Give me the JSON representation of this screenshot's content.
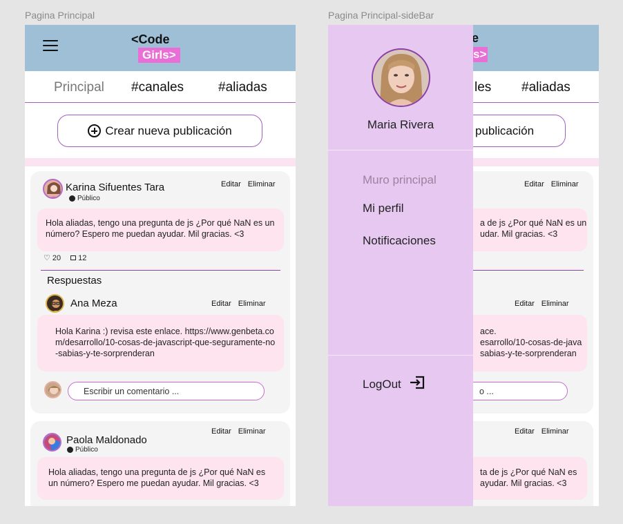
{
  "frames": {
    "left_label": "Pagina Principal",
    "right_label": "Pagina Principal-sideBar"
  },
  "header": {
    "logo_line1": "<Code",
    "logo_line2": "Girls>"
  },
  "tabs": [
    {
      "label": "Principal"
    },
    {
      "label": "#canales"
    },
    {
      "label": "#aliadas"
    }
  ],
  "create_button": "Crear nueva publicación",
  "posts": [
    {
      "author": "Karina Sifuentes Tara",
      "visibility": "Público",
      "edit": "Editar",
      "delete": "Eliminar",
      "body": "Hola aliadas, tengo una pregunta de js ¿Por qué NaN es un número? Espero me puedan ayudar. Mil gracias. <3",
      "likes": "20",
      "comments": "12",
      "replies_title": "Respuestas",
      "reply": {
        "author": "Ana Meza",
        "edit": "Editar",
        "delete": "Eliminar",
        "body": "Hola Karina :) revisa este enlace. https://www.genbeta.com/desarrollo/10-cosas-de-javascript-que-seguramente-no-sabias-y-te-sorprenderan"
      },
      "comment_placeholder": "Escribir un comentario ..."
    },
    {
      "author": "Paola Maldonado",
      "visibility": "Público",
      "edit": "Editar",
      "delete": "Eliminar",
      "body": "Hola aliadas, tengo una pregunta de js ¿Por qué NaN es un número? Espero me puedan ayudar. Mil gracias. <3"
    }
  ],
  "right_visible": {
    "logo_line1_fragment": "e",
    "logo_line2_fragment": "s>",
    "tab_fragment": "les",
    "tab_aliadas": "#aliadas",
    "create_fragment": "publicación",
    "edit": "Editar",
    "delete": "Eliminar",
    "post1_fragment_line1": "a de js ¿Por qué NaN es un",
    "post1_fragment_line2": "udar. Mil gracias. <3",
    "reply_fragment_line1": "ace.",
    "reply_fragment_line2": "esarrollo/10-cosas-de-java",
    "reply_fragment_line3": "sabias-y-te-sorprenderan",
    "comment_fragment": "o ...",
    "post2_fragment_line1": "ta de js ¿Por qué NaN es",
    "post2_fragment_line2": "ayudar. Mil gracias. <3"
  },
  "sidebar": {
    "user_name": "Maria Rivera",
    "items": [
      {
        "label": "Muro principal"
      },
      {
        "label": "Mi perfil"
      },
      {
        "label": "Notificaciones"
      }
    ],
    "logout": "LogOut"
  },
  "colors": {
    "header": "#9ebfd6",
    "accent": "#a45ec0",
    "logo_pink": "#e96fd6",
    "bubble": "#fde4ee",
    "sidebar": "#e6c8f1"
  }
}
